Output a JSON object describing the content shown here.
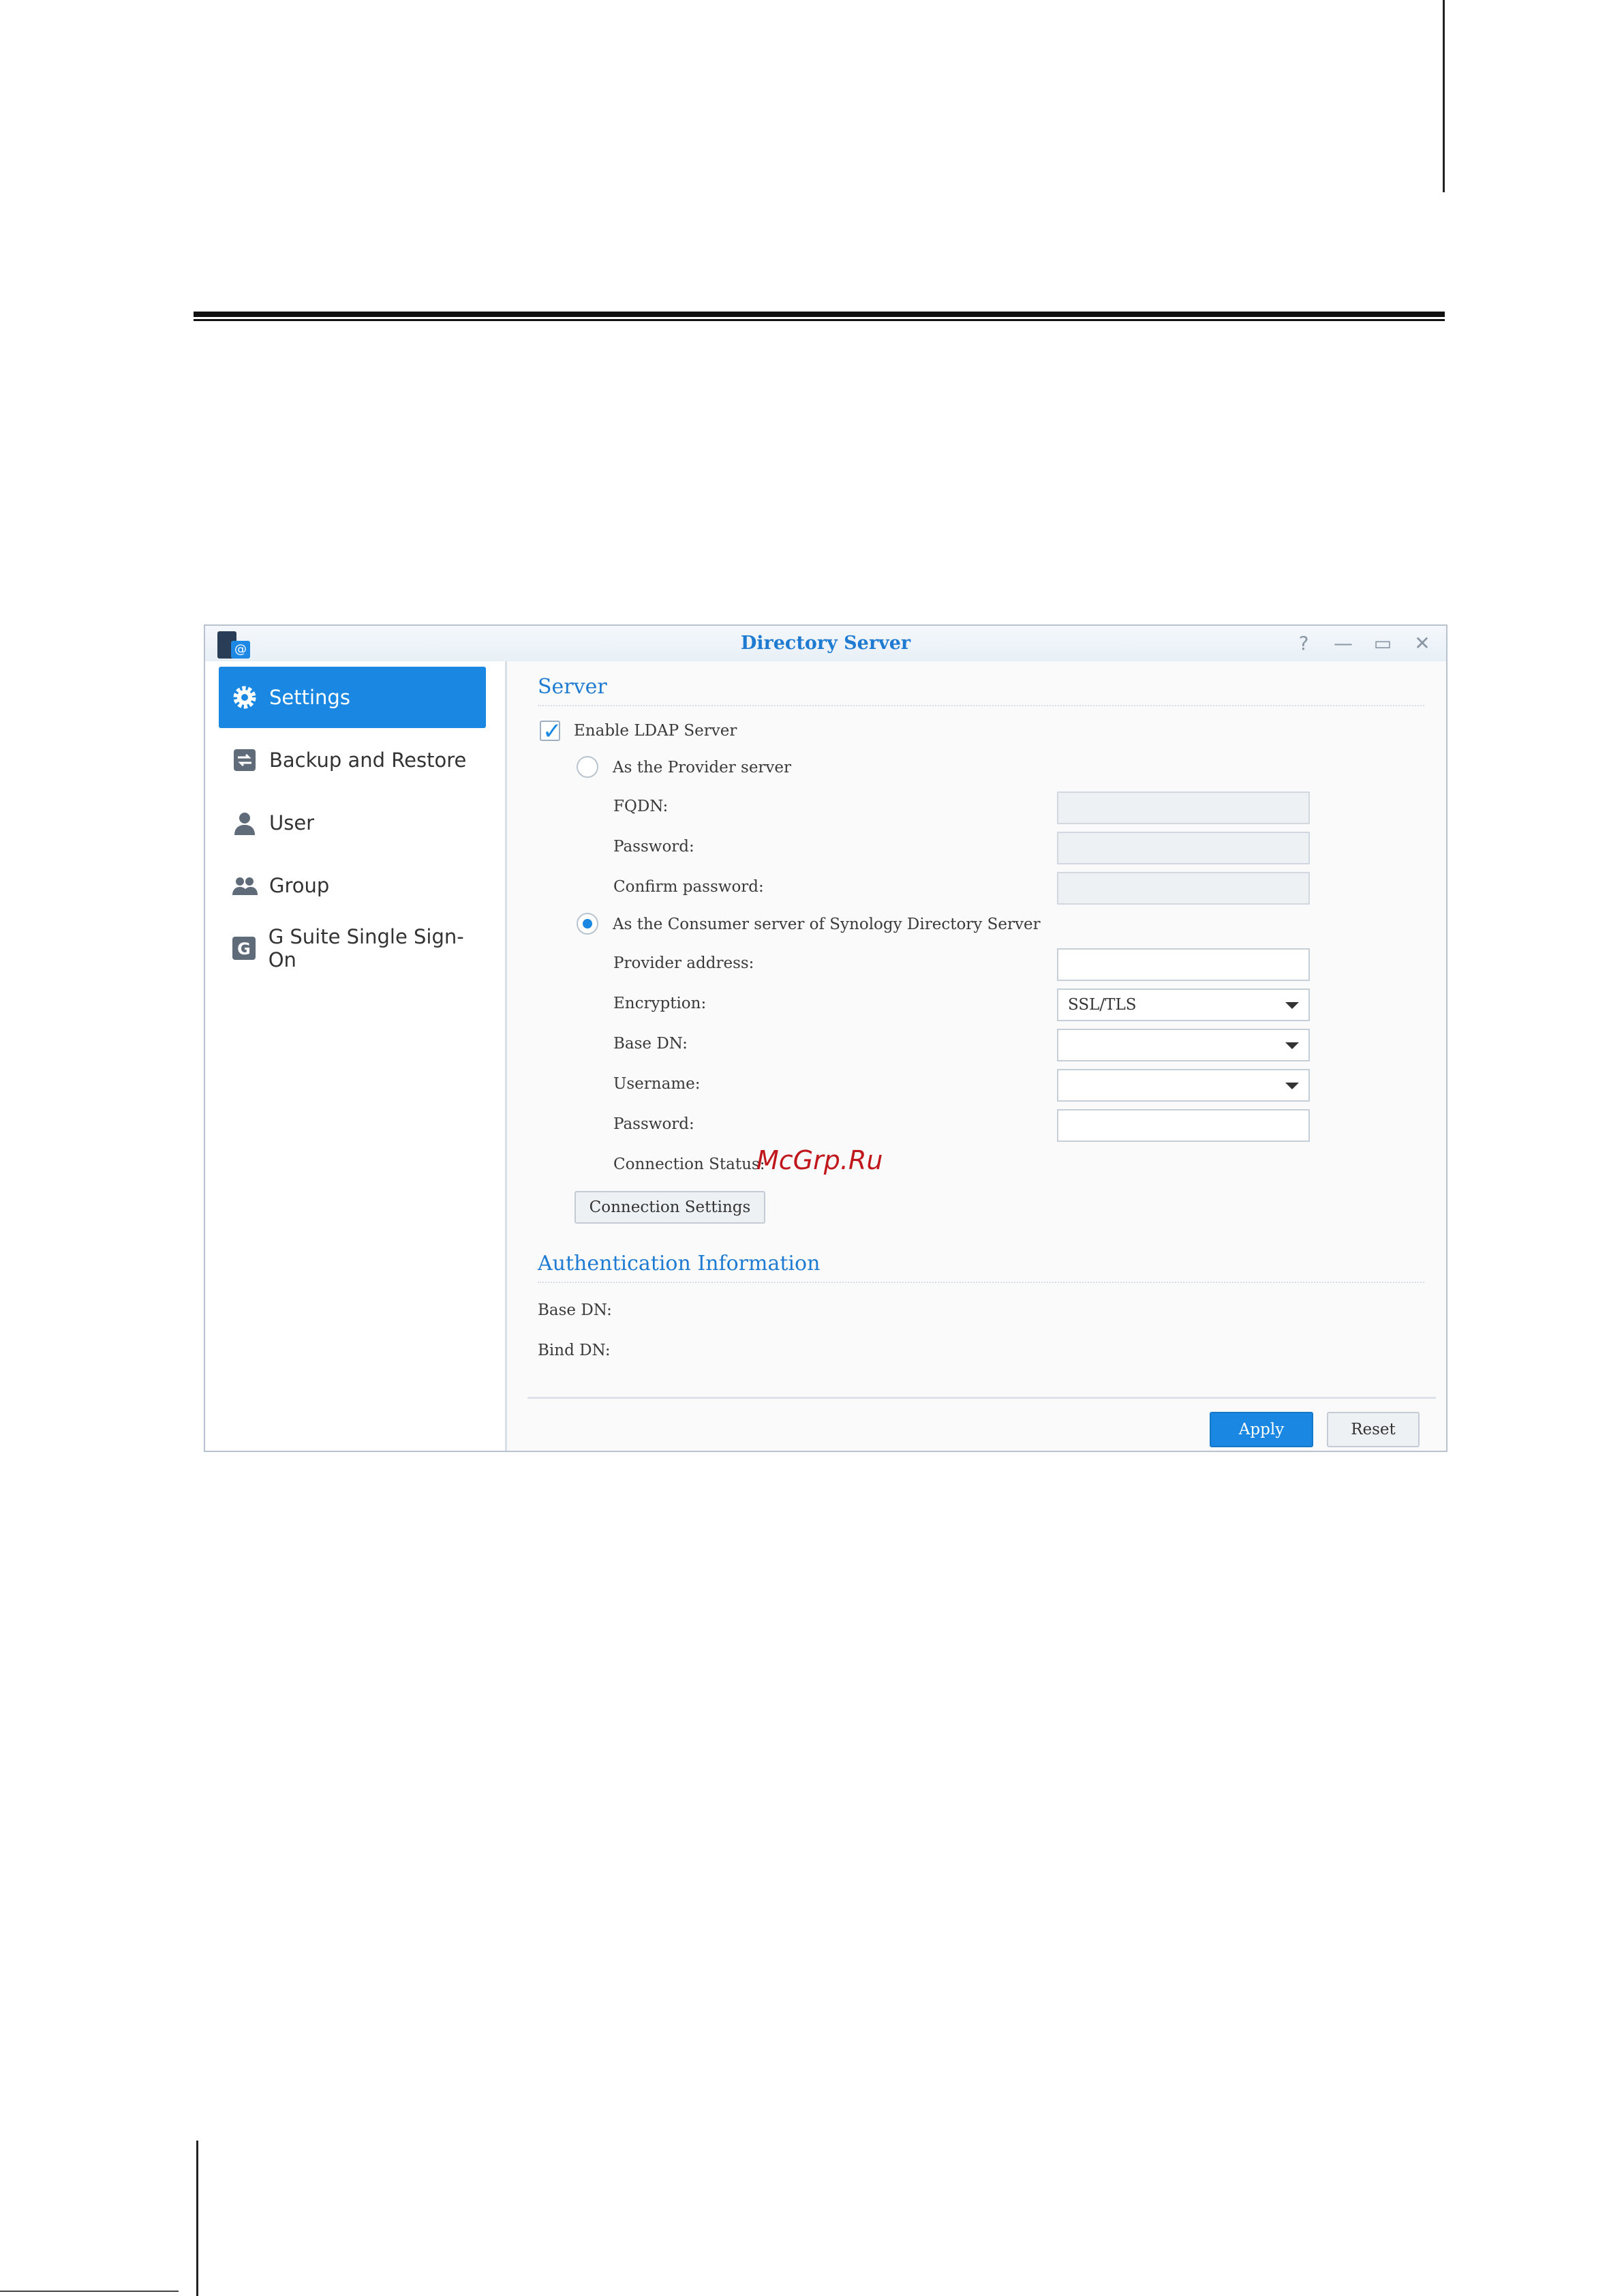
{
  "window": {
    "title": "Directory Server",
    "controls": [
      "help-icon",
      "minimize-icon",
      "maximize-icon",
      "close-icon"
    ]
  },
  "sidebar": {
    "items": [
      {
        "label": "Settings",
        "icon": "gear-icon",
        "active": true
      },
      {
        "label": "Backup and Restore",
        "icon": "backup-restore-icon",
        "active": false
      },
      {
        "label": "User",
        "icon": "user-icon",
        "active": false
      },
      {
        "label": "Group",
        "icon": "group-icon",
        "active": false
      },
      {
        "label": "G Suite Single Sign-On",
        "icon": "g-suite-icon",
        "active": false
      }
    ]
  },
  "server": {
    "section_title": "Server",
    "enable_ldap": {
      "label": "Enable LDAP Server",
      "checked": true
    },
    "provider": {
      "label": "As the Provider server",
      "selected": false,
      "fqdn_label": "FQDN:",
      "fqdn_value": "",
      "password_label": "Password:",
      "password_value": "",
      "confirm_password_label": "Confirm password:",
      "confirm_password_value": ""
    },
    "consumer": {
      "label": "As the Consumer server of Synology Directory Server",
      "selected": true,
      "provider_address_label": "Provider address:",
      "provider_address_value": "",
      "encryption_label": "Encryption:",
      "encryption_value": "SSL/TLS",
      "base_dn_label": "Base DN:",
      "base_dn_value": "",
      "username_label": "Username:",
      "username_value": "",
      "password_label": "Password:",
      "password_value": "",
      "connection_status_label": "Connection Status:"
    },
    "connection_settings_button": "Connection Settings"
  },
  "auth_info": {
    "section_title": "Authentication Information",
    "base_dn_label": "Base DN:",
    "bind_dn_label": "Bind DN:"
  },
  "footer": {
    "apply_label": "Apply",
    "reset_label": "Reset"
  },
  "watermark": "McGrp.Ru",
  "colors": {
    "accent": "#1a88e2",
    "title": "#1f7bd1",
    "watermark": "#c0171d"
  }
}
